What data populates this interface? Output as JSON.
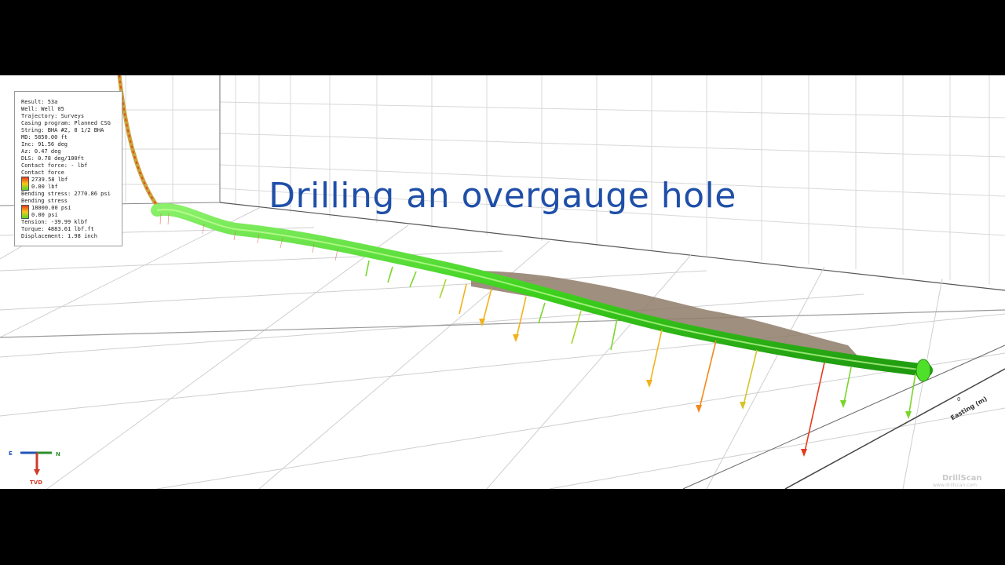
{
  "title": "Drilling an overgauge hole",
  "info": {
    "lines_top": [
      "Result: 53a",
      "Well: Well 05",
      "Trajectory: Surveys",
      "Casing program: Planned CSG",
      "String: BHA #2, 8 1/2 BHA",
      "MD: 5850.00 ft",
      "Inc: 91.56 deg",
      "Az: 0.47 deg",
      "DLS: 0.78 deg/100ft",
      "Contact force: - lbf",
      "Contact force"
    ],
    "contact_legend": {
      "max": "2739.58 lbf",
      "min": "0.00 lbf"
    },
    "bending_stress_line": "Bending stress: 2770.86 psi",
    "bending_title": "Bending stress",
    "bending_legend": {
      "max": "18000.00 psi",
      "min": "0.00 psi"
    },
    "lines_bottom": [
      "Tension: -39.99 klbf",
      "Torque: 4883.61 lbf.ft",
      "Displacement: 1.98 inch"
    ]
  },
  "axes": {
    "e": "E",
    "n": "N",
    "tvd": "TVD",
    "easting": "Easting (m)",
    "zero": "0"
  },
  "watermark": {
    "brand": "DrillScan",
    "url": "www.drillscan.com"
  },
  "colors": {
    "title": "#1f4fa8",
    "pipe": "#3ed21e",
    "hole": "#8e7b68",
    "high_force": "#e53a1e",
    "mid_force": "#f0b21c",
    "low_force": "#79d62a"
  }
}
